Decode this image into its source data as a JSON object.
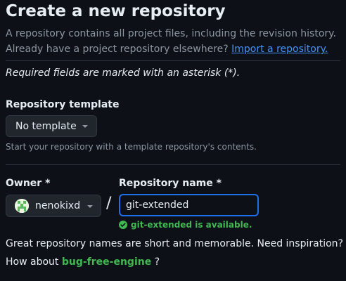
{
  "page": {
    "title": "Create a new repository",
    "description_line1": "A repository contains all project files, including the revision history.",
    "description_line2": "Already have a project repository elsewhere?",
    "import_link": "Import a repository.",
    "required_note": "Required fields are marked with an asterisk (*)."
  },
  "template": {
    "label": "Repository template",
    "selected": "No template",
    "hint": "Start your repository with a template repository's contents."
  },
  "owner": {
    "label": "Owner *",
    "selected": "nenokixd"
  },
  "separator": "/",
  "repo_name": {
    "label": "Repository name *",
    "value": "git-extended",
    "availability": "git-extended is available."
  },
  "suggestion": {
    "line1": "Great repository names are short and memorable. Need inspiration?",
    "prefix": "How about",
    "name": "bug-free-engine",
    "suffix": "?"
  },
  "colors": {
    "background": "#0d1117",
    "link": "#4493f8",
    "success": "#3fb950",
    "focus_border": "#1f6feb"
  }
}
